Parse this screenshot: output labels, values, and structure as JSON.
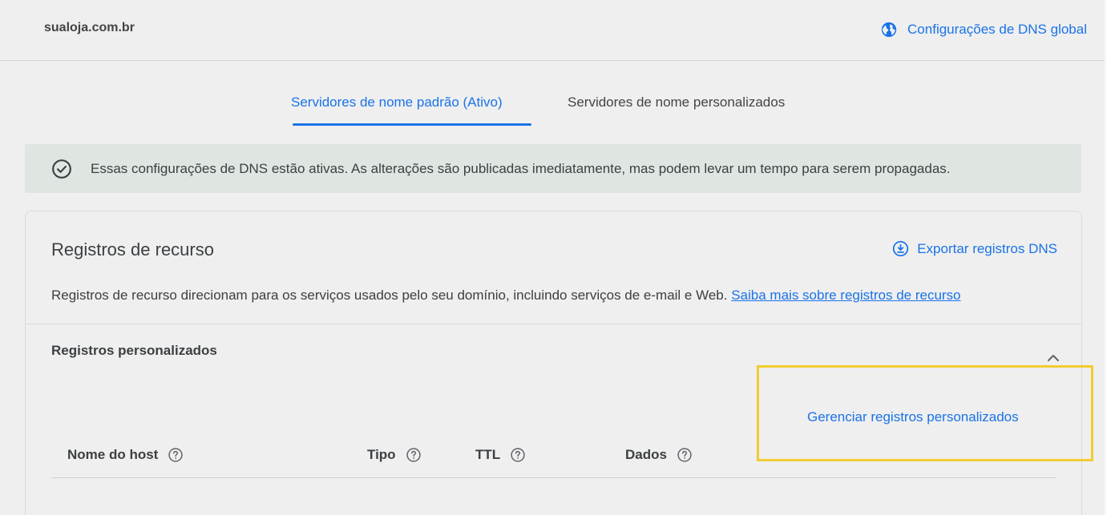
{
  "header": {
    "domain": "sualoja.com.br",
    "global_dns_label": "Configurações de DNS global"
  },
  "tabs": [
    {
      "label": "Servidores de nome padrão (Ativo)",
      "active": true
    },
    {
      "label": "Servidores de nome personalizados",
      "active": false
    }
  ],
  "banner": {
    "text": "Essas configurações de DNS estão ativas. As alterações são publicadas imediatamente, mas podem levar um tempo para serem propagadas."
  },
  "resource_records": {
    "title": "Registros de recurso",
    "export_label": "Exportar registros DNS",
    "description": "Registros de recurso direcionam para os serviços usados pelo seu domínio, incluindo serviços de e-mail e Web.",
    "learn_more_link": "Saiba mais sobre registros de recurso"
  },
  "custom_records": {
    "title": "Registros personalizados",
    "manage_link": "Gerenciar registros personalizados",
    "columns": [
      "Nome do host",
      "Tipo",
      "TTL",
      "Dados"
    ]
  },
  "colors": {
    "accent": "#1a73e8",
    "banner_bg": "#dfe6e1",
    "highlight": "#f2cc30"
  }
}
